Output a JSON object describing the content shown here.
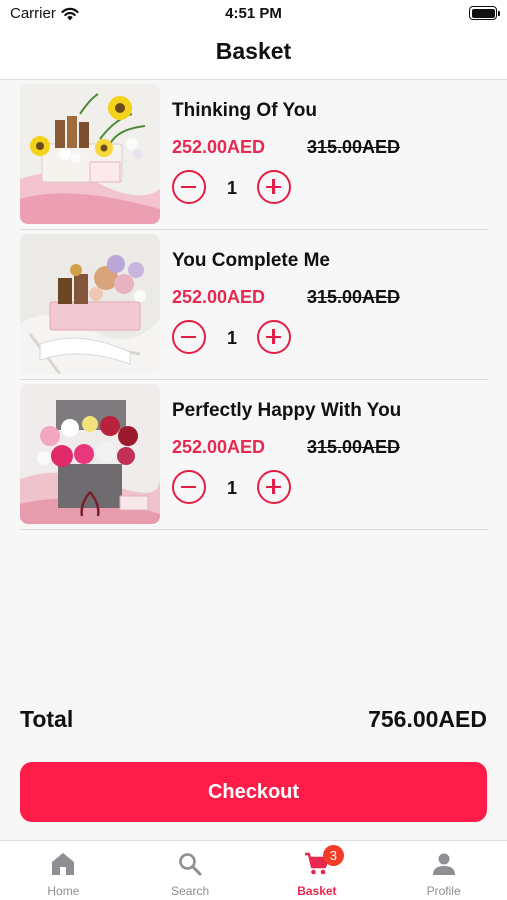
{
  "status_bar": {
    "carrier": "Carrier",
    "time": "4:51 PM"
  },
  "header": {
    "title": "Basket"
  },
  "items": [
    {
      "name": "Thinking Of You",
      "price": "252.00AED",
      "original_price": "315.00AED",
      "quantity": "1"
    },
    {
      "name": "You Complete Me",
      "price": "252.00AED",
      "original_price": "315.00AED",
      "quantity": "1"
    },
    {
      "name": "Perfectly Happy With You",
      "price": "252.00AED",
      "original_price": "315.00AED",
      "quantity": "1"
    }
  ],
  "summary": {
    "total_label": "Total",
    "total_value": "756.00AED"
  },
  "checkout": {
    "label": "Checkout"
  },
  "tab_bar": {
    "tabs": [
      {
        "label": "Home",
        "icon": "home-icon",
        "active": false
      },
      {
        "label": "Search",
        "icon": "search-icon",
        "active": false
      },
      {
        "label": "Basket",
        "icon": "cart-icon",
        "active": true,
        "badge": "3"
      },
      {
        "label": "Profile",
        "icon": "person-icon",
        "active": false
      }
    ]
  },
  "colors": {
    "accent": "#e8284f",
    "checkout_bg": "#ff1c49",
    "badge_bg": "#f43b2a",
    "inactive_tab": "#8e8e93"
  }
}
